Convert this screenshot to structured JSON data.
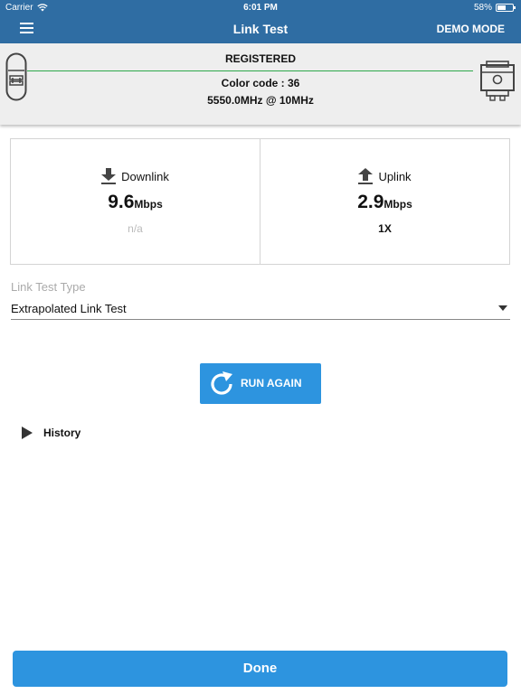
{
  "status_bar": {
    "carrier": "Carrier",
    "time": "6:01 PM",
    "battery_text": "58%",
    "battery_level": 0.58
  },
  "nav": {
    "title": "Link Test",
    "demo_mode": "DEMO MODE"
  },
  "link": {
    "state": "REGISTERED",
    "color_code": "Color code : 36",
    "frequency": "5550.0MHz @ 10MHz"
  },
  "downlink": {
    "label": "Downlink",
    "value": "9.6",
    "unit": "Mbps",
    "detail": "n/a"
  },
  "uplink": {
    "label": "Uplink",
    "value": "2.9",
    "unit": "Mbps",
    "detail": "1X"
  },
  "link_test_type": {
    "label": "Link Test Type",
    "value": "Extrapolated Link Test"
  },
  "run_again": {
    "label": "RUN AGAIN"
  },
  "history": {
    "label": "History"
  },
  "done": {
    "label": "Done"
  },
  "colors": {
    "nav_blue": "#2f6da3",
    "button_blue": "#2d94df",
    "link_green": "#2da84a"
  }
}
